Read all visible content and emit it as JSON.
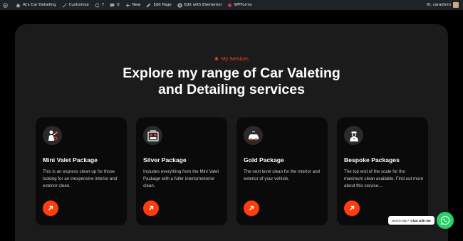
{
  "adminbar": {
    "site_name": "AJ's Car Detailing",
    "customize": "Customize",
    "updates_count": "7",
    "comments_count": "0",
    "new_label": "New",
    "edit_page": "Edit Page",
    "edit_elementor": "Edit with Elementor",
    "wpforms": "WPForms",
    "greeting": "Hi, caradmin"
  },
  "hero": {
    "eyebrow": "My Services",
    "headline_line1": "Explore my range of Car Valeting",
    "headline_line2": "and Detailing services"
  },
  "cards": [
    {
      "title": "Mini Valet Package",
      "desc": "This is an express clean-up for those looking for an inexpensive interior and exterior clean.",
      "icon": "person-cleaning-icon"
    },
    {
      "title": "Silver Package",
      "desc": "Includes everything from the Mini Valet Package with a fuller interior/exterior clean.",
      "icon": "car-wash-icon"
    },
    {
      "title": "Gold Package",
      "desc": "The next level clean for the interior and exterior of your vehicle.",
      "icon": "car-icon"
    },
    {
      "title": "Bespoke Packages",
      "desc": "The top end of the scale for the maximum clean available. Find out more about this service...",
      "icon": "chauffeur-icon"
    }
  ],
  "chat": {
    "need_help": "Need Help?",
    "chat_with_me": "Chat with me",
    "icon": "whatsapp-icon"
  },
  "colors": {
    "accent": "#ff3d0d",
    "panel": "#1b1b1b",
    "card": "#0a0a0a",
    "whatsapp": "#25d366"
  }
}
